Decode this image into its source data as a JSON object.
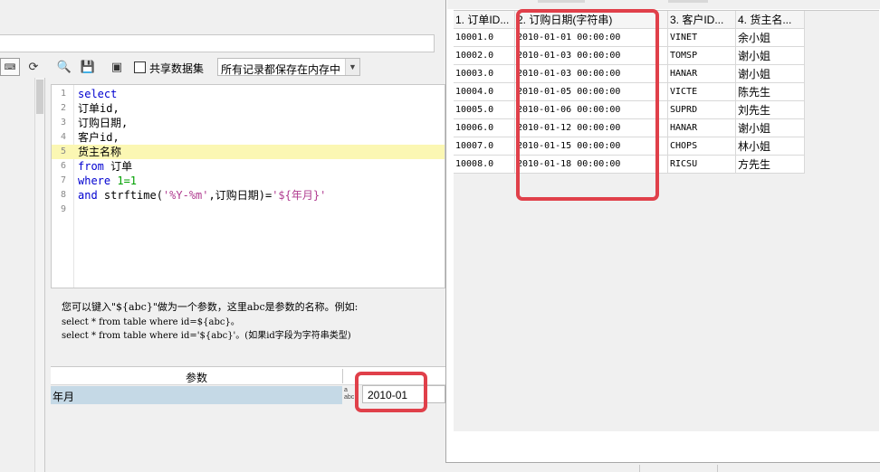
{
  "toolbar": {
    "refresh_icon": "refresh-icon",
    "share_label": "共享数据集",
    "share_checked": false,
    "mode_value": "所有记录都保存在内存中",
    "icons": [
      "preview-icon",
      "save-icon",
      "database-icon"
    ]
  },
  "editor": {
    "lines": [
      {
        "n": "1",
        "parts": [
          {
            "t": "select",
            "c": "kw"
          }
        ]
      },
      {
        "n": "2",
        "parts": [
          {
            "t": "订单id,",
            "c": ""
          }
        ]
      },
      {
        "n": "3",
        "parts": [
          {
            "t": "订购日期,",
            "c": ""
          }
        ]
      },
      {
        "n": "4",
        "parts": [
          {
            "t": "客户id,",
            "c": ""
          }
        ]
      },
      {
        "n": "5",
        "parts": [
          {
            "t": "货主名称",
            "c": ""
          }
        ],
        "highlight": true
      },
      {
        "n": "6",
        "parts": [
          {
            "t": "from",
            "c": "kw"
          },
          {
            "t": " 订单",
            "c": ""
          }
        ]
      },
      {
        "n": "7",
        "parts": [
          {
            "t": "where",
            "c": "kw"
          },
          {
            "t": " ",
            "c": ""
          },
          {
            "t": "1=1",
            "c": "num"
          }
        ]
      },
      {
        "n": "8",
        "parts": [
          {
            "t": "and",
            "c": "kw"
          },
          {
            "t": " strftime(",
            "c": ""
          },
          {
            "t": "'%Y-%m'",
            "c": "str"
          },
          {
            "t": ",订购日期)=",
            "c": ""
          },
          {
            "t": "'${年月}'",
            "c": "str"
          }
        ]
      },
      {
        "n": "9",
        "parts": []
      }
    ]
  },
  "hint": {
    "line1": "您可以键入\"${abc}\"做为一个参数，这里abc是参数的名称。例如:",
    "line2": "select * from table where id=${abc}。",
    "line3": "select * from table where id='${abc}'。(如果id字段为字符串类型)"
  },
  "params": {
    "header": "参数",
    "row_name": "年月",
    "type_icon": "abc",
    "row_value": "2010-01"
  },
  "result": {
    "headers": [
      "1. 订单ID...",
      "2. 订购日期(字符串)",
      "3. 客户ID...",
      "4. 货主名..."
    ],
    "rows": [
      [
        "10001.0",
        "2010-01-01 00:00:00",
        "VINET",
        "余小姐"
      ],
      [
        "10002.0",
        "2010-01-03 00:00:00",
        "TOMSP",
        "谢小姐"
      ],
      [
        "10003.0",
        "2010-01-03 00:00:00",
        "HANAR",
        "谢小姐"
      ],
      [
        "10004.0",
        "2010-01-05 00:00:00",
        "VICTE",
        "陈先生"
      ],
      [
        "10005.0",
        "2010-01-06 00:00:00",
        "SUPRD",
        "刘先生"
      ],
      [
        "10006.0",
        "2010-01-12 00:00:00",
        "HANAR",
        "谢小姐"
      ],
      [
        "10007.0",
        "2010-01-15 00:00:00",
        "CHOPS",
        "林小姐"
      ],
      [
        "10008.0",
        "2010-01-18 00:00:00",
        "RICSU",
        "方先生"
      ]
    ]
  },
  "colors": {
    "highlight_line": "#fbf7b3",
    "keyword": "#0000d0",
    "number": "#00a000",
    "string": "#b03c90",
    "annotation": "#e0404a",
    "param_row": "#c5d9e6"
  }
}
